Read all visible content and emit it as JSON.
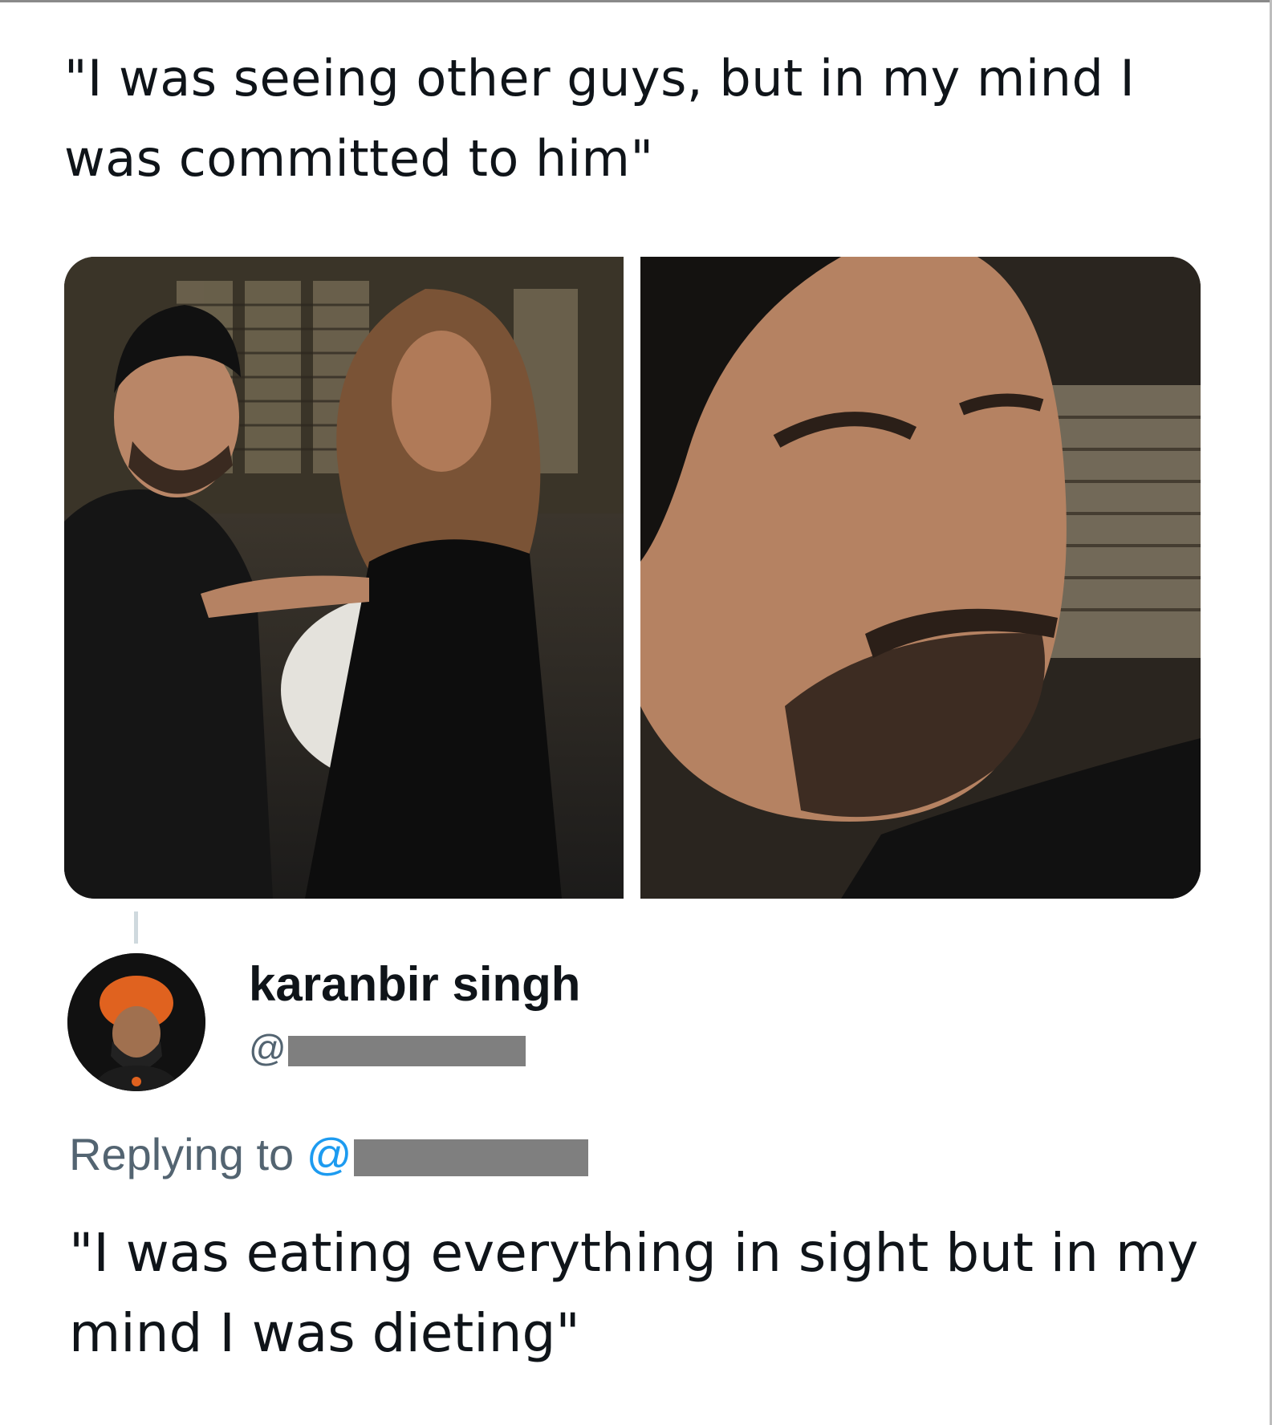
{
  "post": {
    "text": "\"I was seeing other guys, but in my mind I was committed to him\""
  },
  "media": {
    "left_image": "two-people-talk-show-photo",
    "right_image": "man-closeup-reaction-photo"
  },
  "reply": {
    "display_name": "karanbir singh",
    "handle_prefix": "@",
    "replying_label": "Replying to",
    "replying_mention_prefix": "@",
    "text": "\"I was eating everything in sight but in my mind I was dieting\""
  },
  "colors": {
    "text": "#0f1419",
    "secondary_text": "#536471",
    "mention": "#1d9bf0",
    "redaction": "#7f7f7f",
    "avatar_turban": "#e0621f"
  }
}
